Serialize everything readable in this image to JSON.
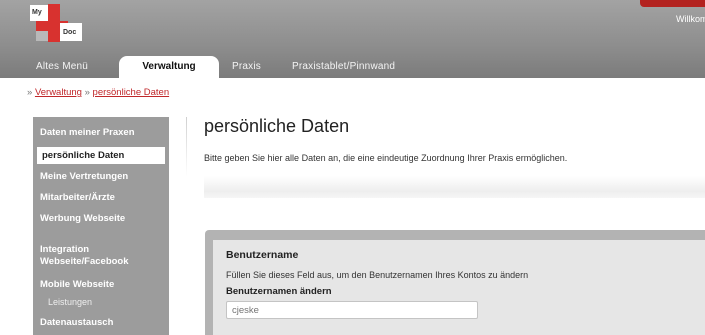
{
  "header": {
    "logo_text_top": "My",
    "logo_text_bottom": "Doc",
    "welcome_text": "Willkom"
  },
  "tabs": [
    {
      "label": "Altes Menü",
      "active": false
    },
    {
      "label": "Verwaltung",
      "active": true
    },
    {
      "label": "Praxis",
      "active": false
    },
    {
      "label": "Praxistablet/Pinnwand",
      "active": false
    }
  ],
  "breadcrumb": {
    "prefix": "»",
    "item1": "Verwaltung",
    "separator": "»",
    "item2": "persönliche Daten"
  },
  "sidebar": {
    "items": [
      {
        "label": "Daten meiner Praxen"
      },
      {
        "label": "persönliche Daten",
        "active": true
      },
      {
        "label": "Meine Vertretungen"
      },
      {
        "label": "Mitarbeiter/Ärzte"
      },
      {
        "label": "Werbung Webseite"
      },
      {
        "label": "Integration"
      },
      {
        "label": "Webseite/Facebook"
      },
      {
        "label": "Mobile Webseite"
      },
      {
        "label": "Leistungen",
        "sub": true
      },
      {
        "label": "Datenaustausch"
      }
    ]
  },
  "main": {
    "title": "persönliche Daten",
    "intro": "Bitte geben Sie hier alle Daten an, die eine eindeutige Zuordnung Ihrer Praxis ermöglichen."
  },
  "username_panel": {
    "heading": "Benutzername",
    "description": "Füllen Sie dieses Feld aus, um den Benutzernamen Ihres Kontos zu ändern",
    "field_label": "Benutzernamen ändern",
    "field_placeholder": "cjeske"
  },
  "colors": {
    "accent": "#c0282b",
    "header_bg": "#8d8d8d",
    "sidebar_bg": "#9c9c9c"
  }
}
